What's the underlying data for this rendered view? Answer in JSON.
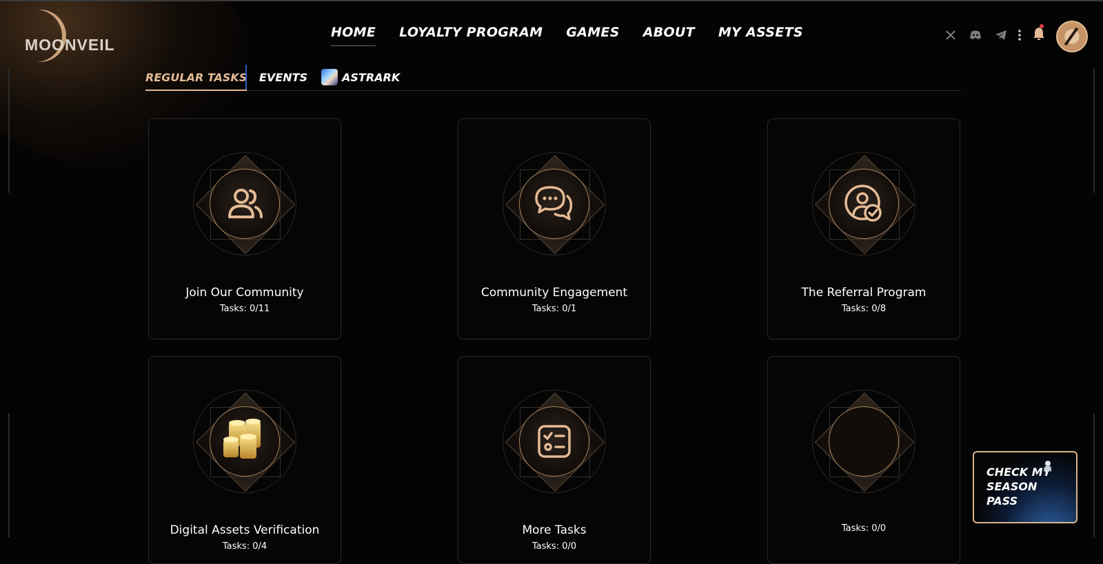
{
  "brand": {
    "name": "MOONVEIL",
    "accent": "#e4bb95"
  },
  "nav": {
    "items": [
      {
        "label": "HOME",
        "active": true
      },
      {
        "label": "LOYALTY PROGRAM",
        "active": false
      },
      {
        "label": "GAMES",
        "active": false
      },
      {
        "label": "ABOUT",
        "active": false
      },
      {
        "label": "MY ASSETS",
        "active": false
      }
    ]
  },
  "header_icons": [
    "x-icon",
    "discord-icon",
    "telegram-icon",
    "more-vertical-icon",
    "bell-icon",
    "avatar"
  ],
  "notification": {
    "has_unread": true,
    "dot_color": "#e23b3b"
  },
  "tabs": [
    {
      "label": "REGULAR TASKS",
      "active": true
    },
    {
      "label": "EVENTS",
      "active": false
    },
    {
      "label": "ASTRARK",
      "active": false,
      "icon": "astrark-game-icon"
    }
  ],
  "cards": [
    {
      "title": "Join Our Community",
      "count": "Tasks: 0/11",
      "icon": "users-icon"
    },
    {
      "title": "Community Engagement",
      "count": "Tasks: 0/1",
      "icon": "chat-bubbles-icon"
    },
    {
      "title": "The Referral Program",
      "count": "Tasks: 0/8",
      "icon": "user-check-icon"
    },
    {
      "title": "Digital Assets Verification",
      "count": "Tasks: 0/4",
      "icon": "gold-coins-icon"
    },
    {
      "title": "More Tasks",
      "count": "Tasks: 0/0",
      "icon": "checklist-icon"
    },
    {
      "title": "",
      "count": "Tasks: 0/0",
      "icon": "empty-icon"
    }
  ],
  "season_pass": {
    "label": "CHECK MY SEASON PASS"
  }
}
